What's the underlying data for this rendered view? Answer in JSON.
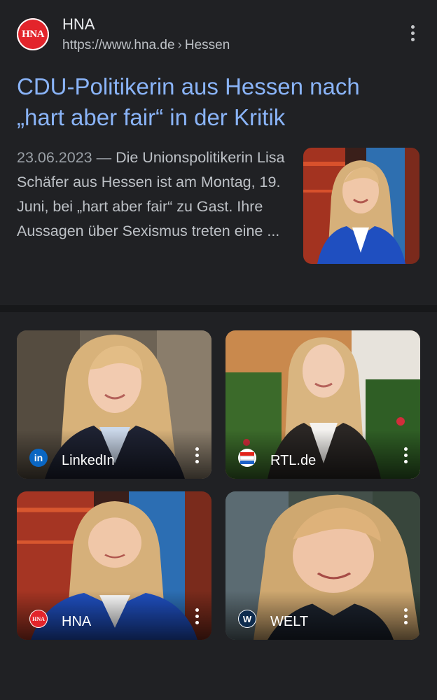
{
  "result": {
    "site_logo_text": "HNA",
    "site_name": "HNA",
    "url": "https://www.hna.de",
    "breadcrumb": "Hessen",
    "title_line1": "CDU-Politikerin aus Hessen nach",
    "title_line2": "„hart aber fair“ in der Kritik",
    "date": "23.06.2023",
    "date_sep": "—",
    "snippet": "Die Unionspolitikerin Lisa Schäfer aus Hessen ist am Montag, 19. Juni, bei „hart aber fair“ zu Gast. Ihre Aussagen über Sexismus treten eine ..."
  },
  "images": [
    {
      "source": "LinkedIn",
      "icon": "linkedin-icon",
      "icon_text": "in"
    },
    {
      "source": "RTL.de",
      "icon": "rtl-icon",
      "icon_text": "RTL"
    },
    {
      "source": "HNA",
      "icon": "hna-icon",
      "icon_text": "HNA"
    },
    {
      "source": "WELT",
      "icon": "welt-icon",
      "icon_text": "W"
    }
  ],
  "colors": {
    "background": "#202124",
    "title_link": "#8ab4f8",
    "snippet_text": "#bdc1c6",
    "hna_red": "#e3242b",
    "linkedin_blue": "#0a66c2"
  }
}
